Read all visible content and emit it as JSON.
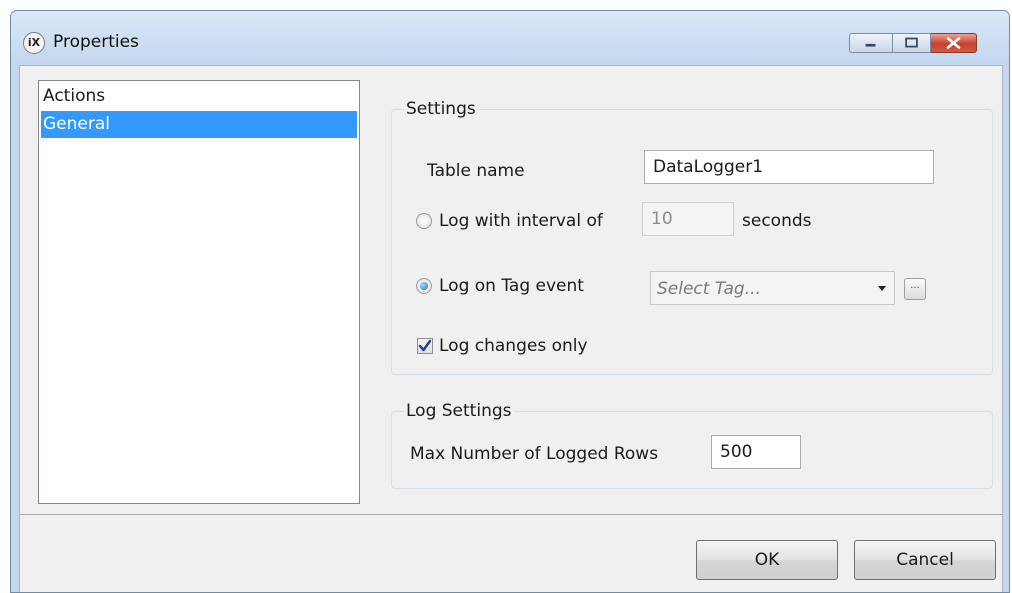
{
  "window": {
    "title": "Properties",
    "app_icon_text": "iX"
  },
  "nav": {
    "items": [
      {
        "label": "Actions",
        "selected": false
      },
      {
        "label": "General",
        "selected": true
      }
    ]
  },
  "settings": {
    "group_label": "Settings",
    "table_name_label": "Table name",
    "table_name_value": "DataLogger1",
    "interval_radio_label": "Log with interval of",
    "interval_value": "10",
    "interval_unit": "seconds",
    "interval_selected": false,
    "tag_event_radio_label": "Log on Tag event",
    "tag_event_selected": true,
    "tag_placeholder": "Select Tag...",
    "browse_button_label": "...",
    "log_changes_label": "Log changes only",
    "log_changes_checked": true
  },
  "log_settings": {
    "group_label": "Log Settings",
    "max_rows_label": "Max Number of Logged Rows",
    "max_rows_value": "500"
  },
  "buttons": {
    "ok": "OK",
    "cancel": "Cancel"
  },
  "colors": {
    "selection": "#3399ff",
    "radio_dot": "#1c6fc0",
    "close_button": "#c6402a"
  }
}
